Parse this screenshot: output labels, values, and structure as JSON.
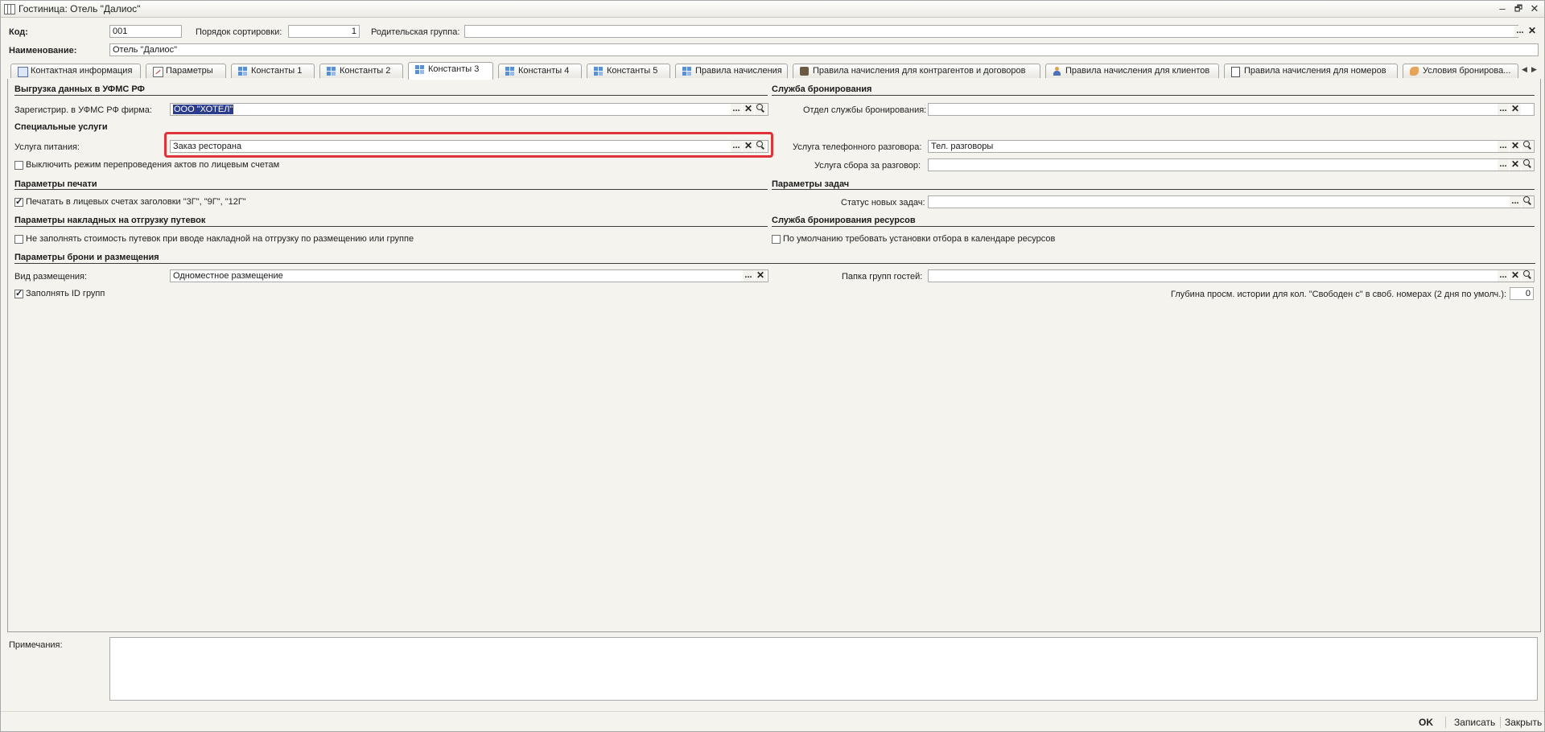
{
  "window": {
    "title": "Гостиница: Отель \"Далиос\""
  },
  "header": {
    "code_label": "Код:",
    "code_value": "001",
    "sort_label": "Порядок сортировки:",
    "sort_value": "1",
    "parent_label": "Родительская группа:",
    "parent_value": "",
    "name_label": "Наименование:",
    "name_value": "Отель \"Далиос\""
  },
  "tabs": [
    {
      "label": "Контактная информация",
      "icon": "contact-card-icon"
    },
    {
      "label": "Параметры",
      "icon": "parameters-icon"
    },
    {
      "label": "Константы 1",
      "icon": "constants-grid-icon"
    },
    {
      "label": "Константы 2",
      "icon": "constants-grid-icon"
    },
    {
      "label": "Константы 3",
      "icon": "constants-grid-icon",
      "active": true
    },
    {
      "label": "Константы 4",
      "icon": "constants-grid-icon"
    },
    {
      "label": "Константы 5",
      "icon": "constants-grid-icon"
    },
    {
      "label": "Правила начисления",
      "icon": "rules-icon"
    },
    {
      "label": "Правила начисления для контрагентов и договоров",
      "icon": "briefcase-icon"
    },
    {
      "label": "Правила начисления для клиентов",
      "icon": "person-icon"
    },
    {
      "label": "Правила начисления для номеров",
      "icon": "document-icon"
    },
    {
      "label": "Условия бронирова...",
      "icon": "handshake-icon"
    }
  ],
  "left": {
    "ufms_section": "Выгрузка данных в УФМС РФ",
    "ufms_firm_label": "Зарегистрир. в УФМС РФ фирма:",
    "ufms_firm_value": "ООО \"ХОТЕЛ\"",
    "special_section": "Специальные услуги",
    "food_label": "Услуга питания:",
    "food_value": "Заказ ресторана",
    "disable_repost_label": "Выключить режим перепроведения актов по лицевым счетам",
    "disable_repost_checked": false,
    "print_section": "Параметры печати",
    "print_headers_label": "Печатать в лицевых счетах заголовки \"3Г\", \"9Г\", \"12Г\"",
    "print_headers_checked": true,
    "waybill_section": "Параметры накладных на отгрузку путевок",
    "waybill_label": "Не заполнять стоимость путевок при вводе накладной на отгрузку по размещению или группе",
    "waybill_checked": false,
    "booking_section": "Параметры брони и размещения",
    "accommodation_label": "Вид размещения:",
    "accommodation_value": "Одноместное размещение",
    "fill_group_id_label": "Заполнять ID групп",
    "fill_group_id_checked": true
  },
  "right": {
    "booking_service_section": "Служба бронирования",
    "booking_dept_label": "Отдел службы бронирования:",
    "booking_dept_value": "",
    "phone_label": "Услуга телефонного разговора:",
    "phone_value": "Тел. разговоры",
    "call_fee_label": "Услуга сбора за разговор:",
    "call_fee_value": "",
    "tasks_section": "Параметры задач",
    "task_status_label": "Статус новых задач:",
    "task_status_value": "",
    "resources_section": "Служба бронирования ресурсов",
    "require_filter_label": "По умолчанию требовать установки отбора в календаре ресурсов",
    "require_filter_checked": false,
    "guest_groups_label": "Папка групп гостей:",
    "guest_groups_value": "",
    "history_depth_label": "Глубина просм. истории для кол. \"Свободен с\" в своб. номерах (2 дня по умолч.):",
    "history_depth_value": "0"
  },
  "notes": {
    "label": "Примечания:",
    "value": ""
  },
  "footer": {
    "ok": "OK",
    "save": "Записать",
    "close": "Закрыть"
  },
  "glyphs": {
    "ellipsis": "...",
    "clear": "✕",
    "minimize": "–",
    "restore": "🗗",
    "close": "✕",
    "tab_prev": "◀",
    "tab_next": "▶"
  },
  "colors": {
    "highlight_border": "#e03339",
    "selection": "#2b3c8c",
    "background": "#f4f3ee"
  }
}
